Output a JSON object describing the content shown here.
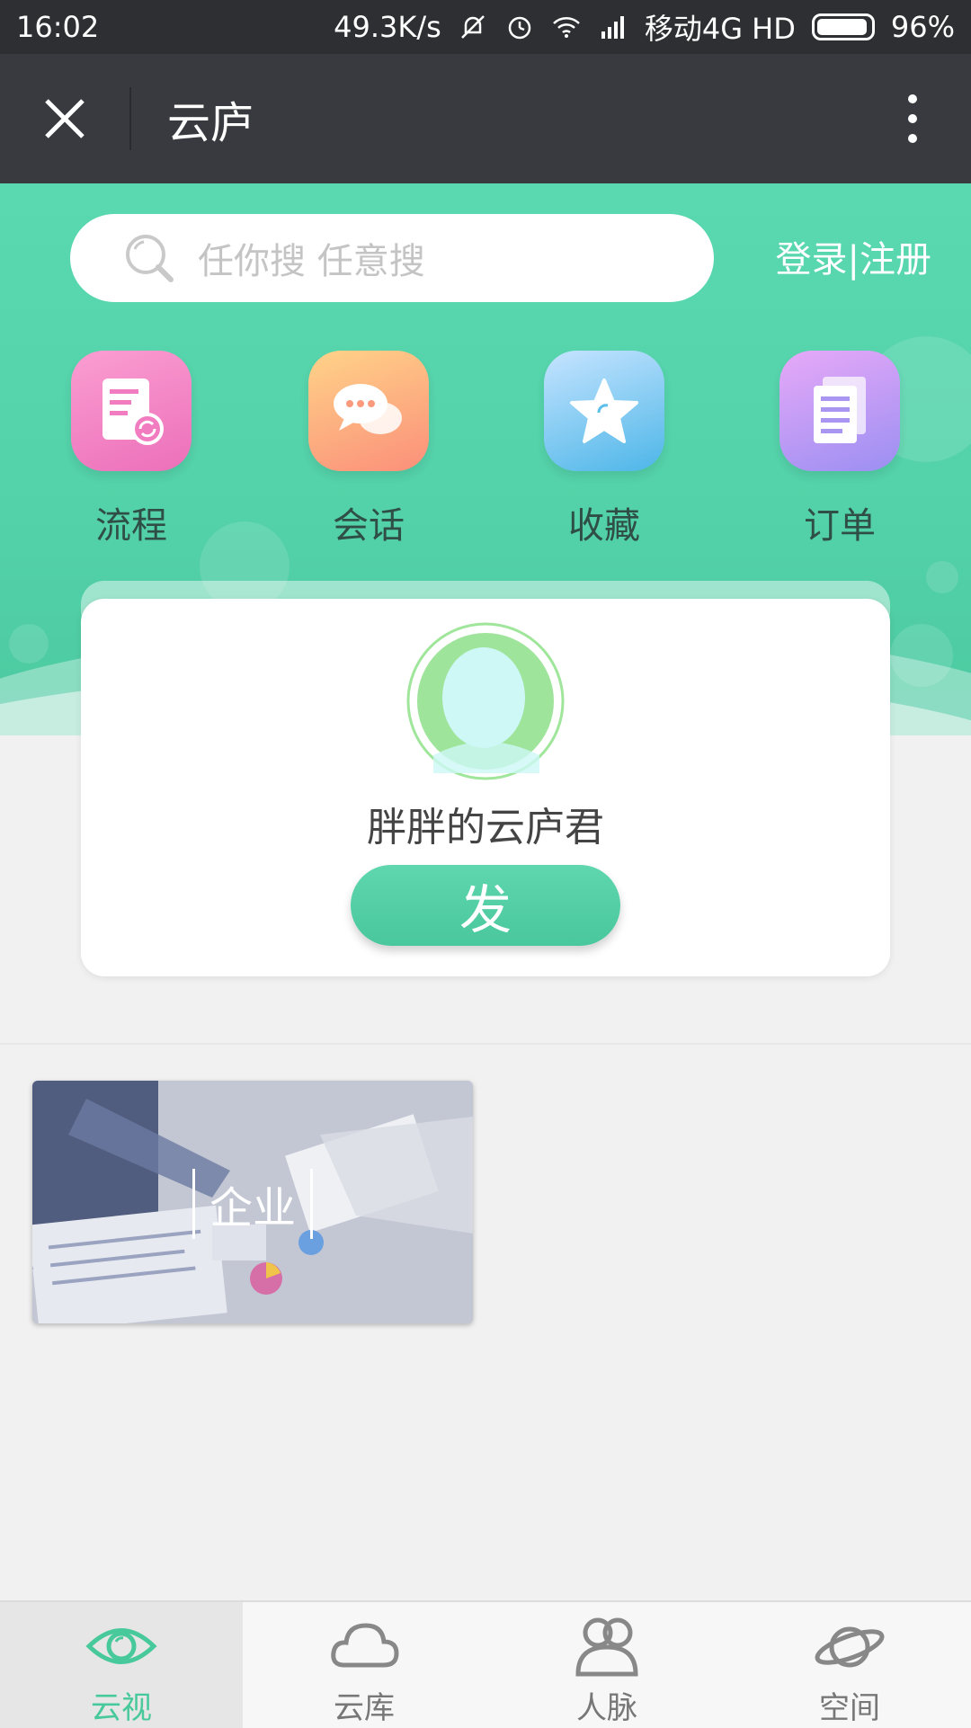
{
  "status_bar": {
    "time": "16:02",
    "speed": "49.3K/s",
    "carrier": "移动4G HD",
    "battery": "96%",
    "icons": [
      "mute-icon",
      "alarm-icon",
      "wifi-icon",
      "signal-icon",
      "battery-icon"
    ]
  },
  "title_bar": {
    "title": "云庐",
    "close_icon": "close-icon",
    "more_icon": "more-vertical-icon"
  },
  "header": {
    "search_placeholder": "任你搜 任意搜",
    "login_label": "登录|注册",
    "quick_actions": [
      {
        "label": "流程",
        "icon": "process-doc-icon",
        "color": "#f07cc4"
      },
      {
        "label": "会话",
        "icon": "chat-bubbles-icon",
        "color": "#fca07c"
      },
      {
        "label": "收藏",
        "icon": "star-icon",
        "color": "#5bbfec"
      },
      {
        "label": "订单",
        "icon": "order-doc-icon",
        "color": "#b59cf4"
      }
    ],
    "accent_color": "#53d1a8"
  },
  "profile_card": {
    "username": "胖胖的云庐君",
    "publish_label": "发"
  },
  "content": {
    "tiles": [
      {
        "label": "企业"
      }
    ]
  },
  "bottom_nav": {
    "items": [
      {
        "label": "云视",
        "icon": "eye-icon",
        "active": true
      },
      {
        "label": "云库",
        "icon": "cloud-icon",
        "active": false
      },
      {
        "label": "人脉",
        "icon": "contacts-icon",
        "active": false
      },
      {
        "label": "空间",
        "icon": "planet-icon",
        "active": false
      }
    ]
  }
}
